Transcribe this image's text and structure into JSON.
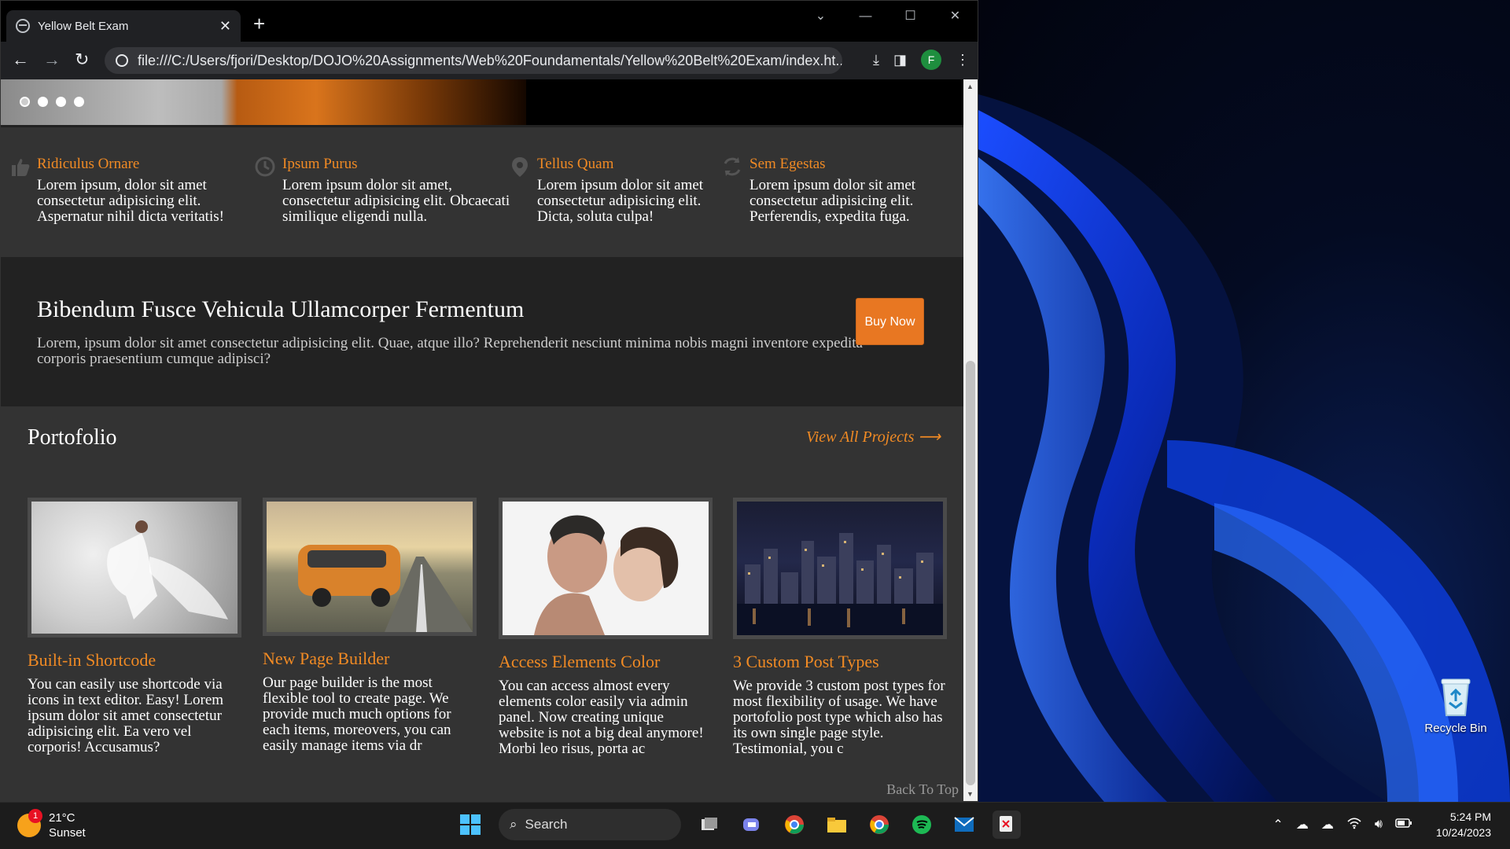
{
  "browser": {
    "tab_title": "Yellow Belt Exam",
    "tab_close": "✕",
    "new_tab": "+",
    "url": "file:///C:/Users/fjori/Desktop/DOJO%20Assignments/Web%20Foundamentals/Yellow%20Belt%20Exam/index.ht...",
    "profile_initial": "F",
    "window_controls": [
      "⌄",
      "—",
      "☐",
      "✕"
    ]
  },
  "features": [
    {
      "title": "Ridiculus Ornare",
      "text": "Lorem ipsum, dolor sit amet consectetur adipisicing elit. Aspernatur nihil dicta veritatis!",
      "icon": "thumbs-up-icon"
    },
    {
      "title": "Ipsum Purus",
      "text": "Lorem ipsum dolor sit amet, consectetur adipisicing elit. Obcaecati similique eligendi nulla.",
      "icon": "clock-icon"
    },
    {
      "title": "Tellus Quam",
      "text": "Lorem ipsum dolor sit amet consectetur adipisicing elit. Dicta, soluta culpa!",
      "icon": "map-pin-icon"
    },
    {
      "title": "Sem Egestas",
      "text": "Lorem ipsum dolor sit amet consectetur adipisicing elit. Perferendis, expedita fuga.",
      "icon": "refresh-icon"
    }
  ],
  "cta": {
    "title": "Bibendum Fusce Vehicula Ullamcorper Fermentum",
    "text": "Lorem, ipsum dolor sit amet consectetur adipisicing elit. Quae, atque illo? Reprehenderit nesciunt minima nobis magni inventore expedita corporis praesentium cumque adipisci?",
    "button": "Buy Now"
  },
  "portfolio": {
    "title": "Portofolio",
    "view_all": "View All Projects ⟶",
    "items": [
      {
        "title": "Built-in Shortcode",
        "text": "You can easily use shortcode via icons in text editor. Easy! Lorem ipsum dolor sit amet consectetur adipisicing elit. Ea vero vel corporis! Accusamus?"
      },
      {
        "title": "New Page Builder",
        "text": "Our page builder is the most flexible tool to create page. We provide much much options for each items, moreovers, you can easily manage items via dr"
      },
      {
        "title": "Access Elements Color",
        "text": "You can access almost every elements color easily via admin panel. Now creating unique website is not a big deal anymore! Morbi leo risus, porta ac"
      },
      {
        "title": "3 Custom Post Types",
        "text": "We provide 3 custom post types for most flexibility of usage. We have portofolio post type which also has its own single page style. Testimonial, you c"
      }
    ],
    "back_to_top": "Back To Top"
  },
  "desktop": {
    "recycle_bin": "Recycle Bin"
  },
  "taskbar": {
    "weather_temp": "21°C",
    "weather_desc": "Sunset",
    "weather_badge": "1",
    "search_label": "Search",
    "time": "5:24 PM",
    "date": "10/24/2023"
  },
  "colors": {
    "accent": "#f08a24",
    "buy_button": "#e87722"
  }
}
